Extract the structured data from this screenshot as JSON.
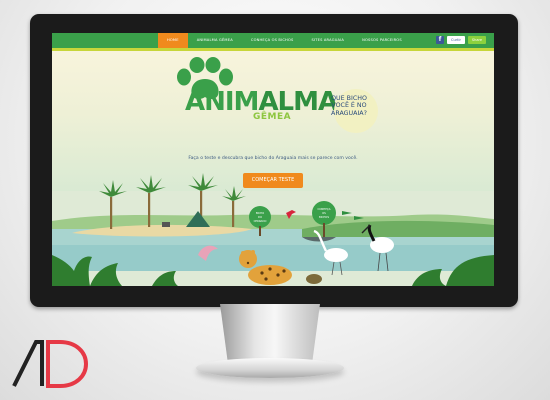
{
  "nav": {
    "items": [
      "HOME",
      "ANIMALMA GÊMEA",
      "CONHEÇA OS BICHOS",
      "SITES ARAGUAIA",
      "NOSSOS PARCEIROS"
    ],
    "active_index": 0
  },
  "social": {
    "facebook_glyph": "f",
    "like_label": "Curtir",
    "share_label": "Share"
  },
  "brand": {
    "title_part1": "ANIM",
    "title_part2": "ALMA",
    "subtitle": "GÊMEA"
  },
  "question": {
    "line1": "QUE BICHO",
    "line2": "VOCÊ É NO",
    "line3": "ARAGUAIA?"
  },
  "intro_text": "Faça o teste e descubra que bicho do Araguaia mais se parece com você.",
  "cta_label": "COMEÇAR TESTE",
  "signs": {
    "left": [
      "BICHO",
      "DO",
      "CERRADO"
    ],
    "right": [
      "CONHEÇA",
      "OS",
      "BICHOS"
    ]
  },
  "footnote": "",
  "colors": {
    "brand_green": "#3aa04a",
    "accent_orange": "#f08a1d",
    "lime": "#c7d63a",
    "question_blue": "#2a4b7c",
    "bezel": "#1b1b1b",
    "logo_red": "#e63946"
  },
  "icons": [
    "paw-icon",
    "facebook-icon",
    "ad-logo"
  ]
}
